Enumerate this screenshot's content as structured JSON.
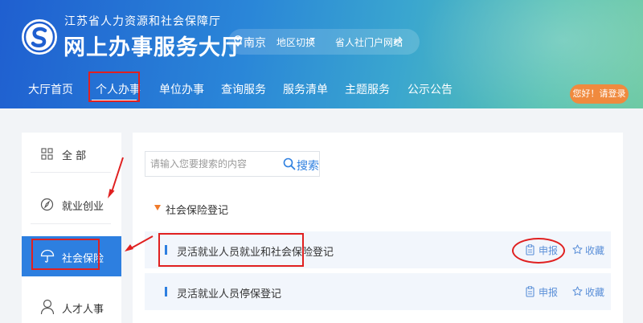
{
  "header": {
    "org_subtitle": "江苏省人力资源和社会保障厅",
    "org_title": "网上办事服务大厅",
    "location": {
      "city": "南京",
      "switch_label": "地区切换",
      "portal_link": "省人社门户网站"
    },
    "nav": [
      {
        "label": "大厅首页",
        "active": false
      },
      {
        "label": "个人办事",
        "active": true
      },
      {
        "label": "单位办事",
        "active": false
      },
      {
        "label": "查询服务",
        "active": false
      },
      {
        "label": "服务清单",
        "active": false
      },
      {
        "label": "主题服务",
        "active": false
      },
      {
        "label": "公示公告",
        "active": false
      }
    ],
    "login_label": "您好！请登录"
  },
  "sidebar": {
    "items": [
      {
        "label": "全 部",
        "icon": "grid-icon",
        "active": false
      },
      {
        "label": "就业创业",
        "icon": "compass-icon",
        "active": false
      },
      {
        "label": "社会保险",
        "icon": "umbrella-icon",
        "active": true
      },
      {
        "label": "人才人事",
        "icon": "person-icon",
        "active": false
      }
    ]
  },
  "search": {
    "placeholder": "请输入您要搜索的内容",
    "button_label": "搜索"
  },
  "category": {
    "title": "社会保险登记"
  },
  "services": [
    {
      "title": "灵活就业人员就业和社会保险登记",
      "apply_label": "申报",
      "fav_label": "收藏"
    },
    {
      "title": "灵活就业人员停保登记",
      "apply_label": "申报",
      "fav_label": "收藏"
    }
  ],
  "colors": {
    "accent": "#2d7fe0",
    "login_button": "#f08a3e",
    "annotation": "#e02020",
    "category_arrow": "#f07a2a"
  }
}
